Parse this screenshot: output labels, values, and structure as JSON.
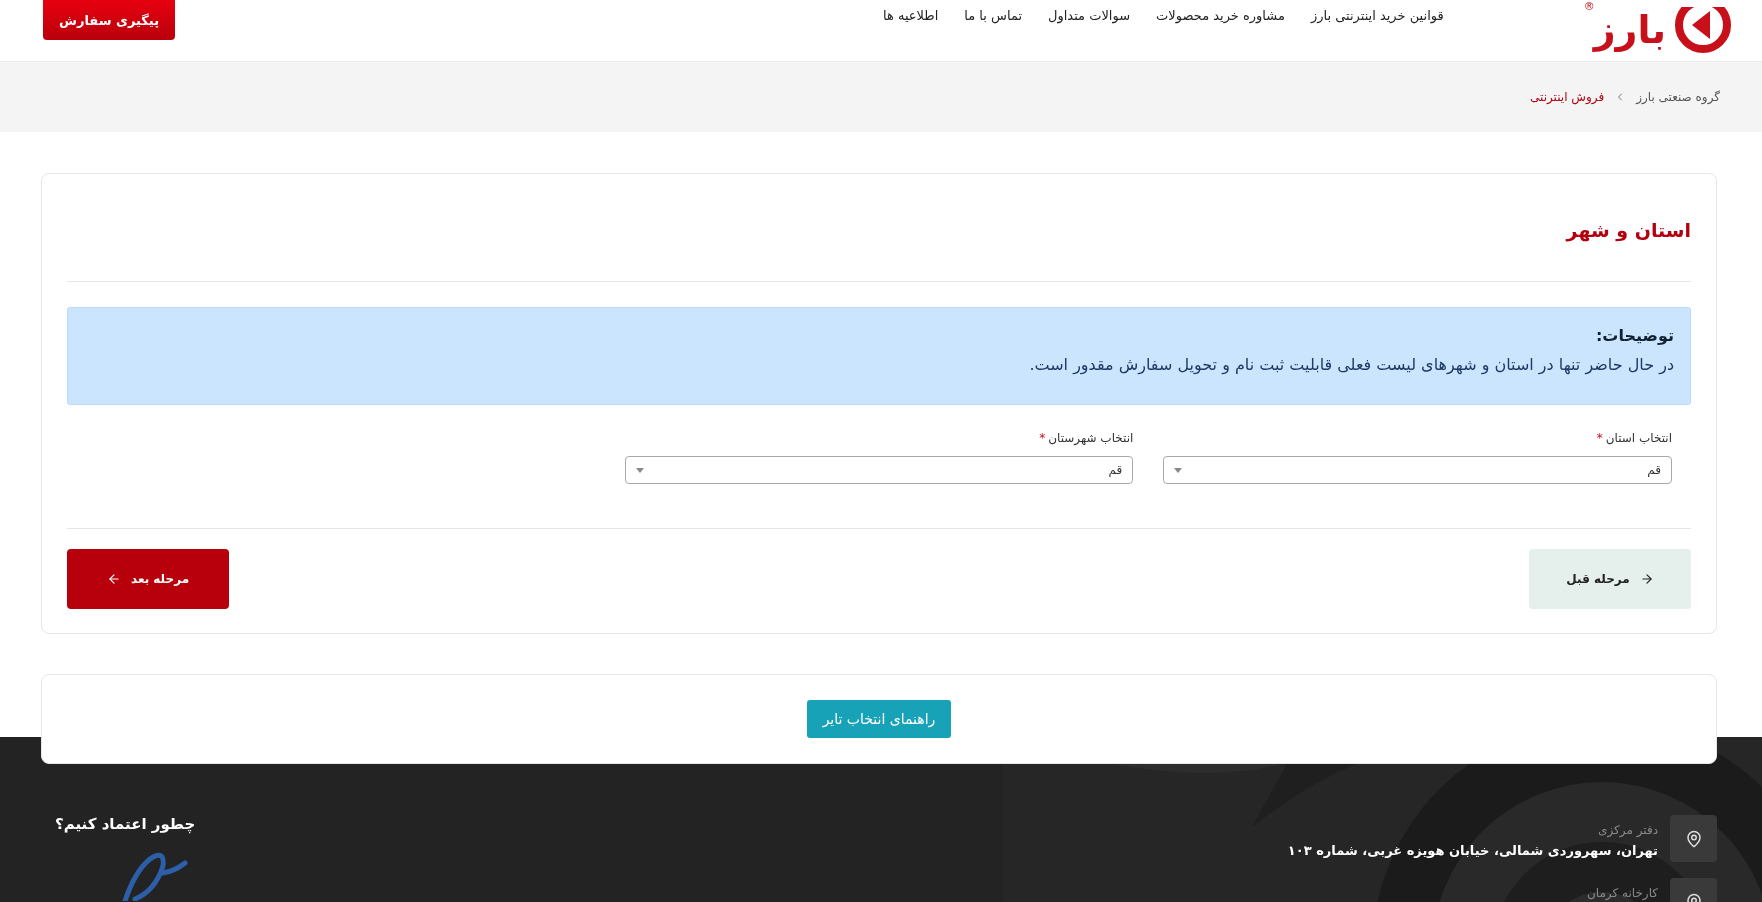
{
  "header": {
    "logo_text": "بارز",
    "logo_mark": "®",
    "nav": [
      {
        "label": "قوانین خرید اینترنتی بارز"
      },
      {
        "label": "مشاوره خرید محصولات"
      },
      {
        "label": "سوالات متداول"
      },
      {
        "label": "تماس با ما"
      },
      {
        "label": "اطلاعیه ها"
      }
    ],
    "track_button": "پیگیری سفارش"
  },
  "breadcrumb": [
    {
      "label": "گروه صنعتی بارز",
      "current": false
    },
    {
      "label": "فروش اینترنتی",
      "current": true
    }
  ],
  "form_card": {
    "title": "استان و شهر",
    "info": {
      "title": "توضیحات:",
      "text": "در حال حاضر تنها در استان و شهرهای لیست فعلی قابلیت ثبت نام و تحویل سفارش مقدور است."
    },
    "fields": [
      {
        "label": "انتخاب استان",
        "required_mark": "*",
        "value": "قم"
      },
      {
        "label": "انتخاب شهرستان",
        "required_mark": "*",
        "value": "قم"
      }
    ],
    "buttons": [
      {
        "kind": "prev",
        "label": "مرحله قبل"
      },
      {
        "kind": "next",
        "label": "مرحله بعد"
      }
    ]
  },
  "guide_button": "راهنمای انتخاب تایر",
  "footer": {
    "heading": "چطور اعتماد کنیم؟",
    "addresses": [
      {
        "label": "دفتر مرکزی",
        "text": "تهران، سهروردی شمالی، خیابان هویزه غربی، شماره ۱۰۳"
      },
      {
        "label": "کارخانه کرمان"
      }
    ]
  }
}
